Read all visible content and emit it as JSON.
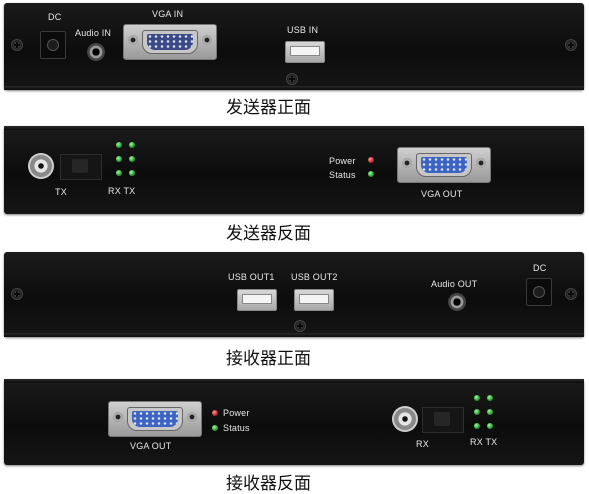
{
  "panels": [
    {
      "caption": "发送器正面",
      "labels": {
        "dc": "DC",
        "audio_in": "Audio IN",
        "vga_in": "VGA IN",
        "usb_in": "USB IN"
      }
    },
    {
      "caption": "发送器反面",
      "labels": {
        "tx": "TX",
        "rx_tx": "RX TX",
        "power": "Power",
        "status": "Status",
        "vga_out": "VGA OUT"
      }
    },
    {
      "caption": "接收器正面",
      "labels": {
        "usb_out1": "USB OUT1",
        "usb_out2": "USB OUT2",
        "audio_out": "Audio OUT",
        "dc": "DC"
      }
    },
    {
      "caption": "接收器反面",
      "labels": {
        "vga_out": "VGA OUT",
        "power": "Power",
        "status": "Status",
        "rx": "RX",
        "rx_tx": "RX TX"
      }
    }
  ],
  "colors": {
    "led_green": "#2fc23f",
    "led_red": "#d42020",
    "panel": "#121212"
  }
}
